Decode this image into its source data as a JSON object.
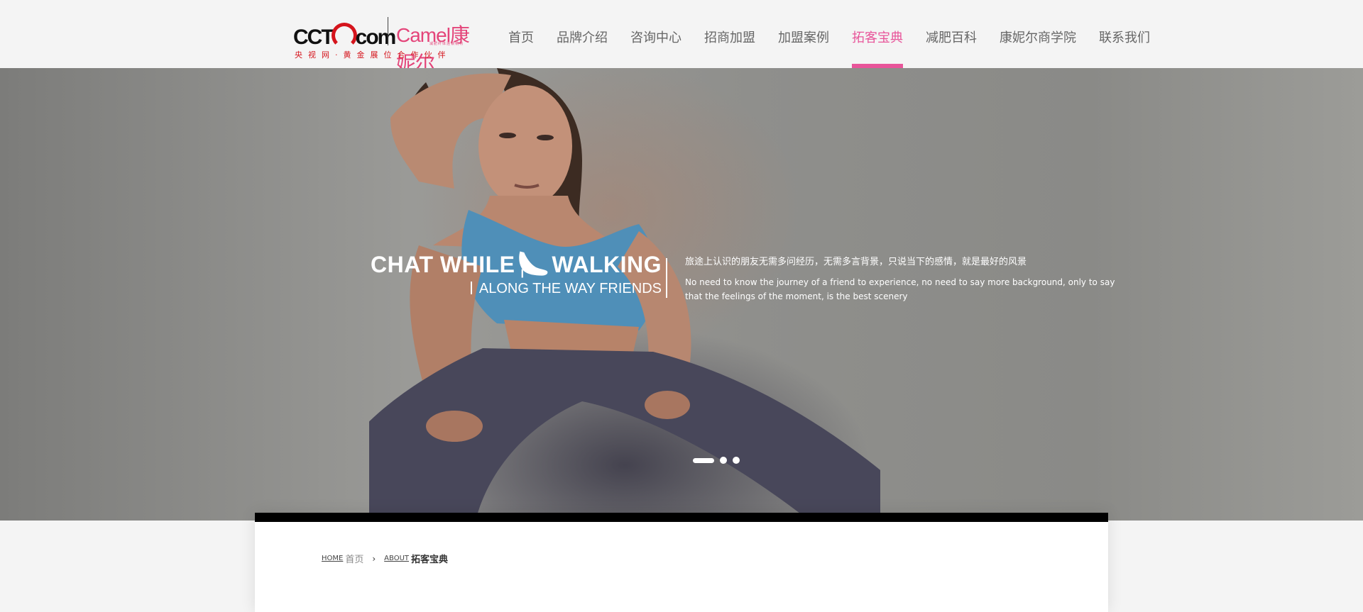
{
  "logo": {
    "cctv_pre": "CCT",
    "cctv_post": "com",
    "camel": "Camel康妮尔",
    "camel_sub": "减肥纤体连锁机构",
    "tagline": "央视网·黄金展位合作伙伴"
  },
  "nav": {
    "items": [
      {
        "label": "首页"
      },
      {
        "label": "品牌介绍"
      },
      {
        "label": "咨询中心"
      },
      {
        "label": "招商加盟"
      },
      {
        "label": "加盟案例"
      },
      {
        "label": "拓客宝典"
      },
      {
        "label": "减肥百科"
      },
      {
        "label": "康妮尔商学院"
      },
      {
        "label": "联系我们"
      }
    ],
    "active_index": 5,
    "accent_color": "#e8559a"
  },
  "banner": {
    "slogan_part1": "CHAT WHILE",
    "slogan_part2": "WALKING",
    "slogan_icon": "high-heel-icon",
    "slogan_sub": "ALONG THE WAY FRIENDS",
    "cn_text": "旅途上认识的朋友无需多问经历，无需多言背景，只说当下的感情，就是最好的风景",
    "en_text": "No need to know the journey of a friend to experience, no need to say more background, only to say that the feelings of the moment, is the best scenery",
    "slides": 3,
    "active_slide": 0
  },
  "breadcrumb": {
    "home_en": "HOME",
    "home_cn": "首页",
    "about_en": "ABOUT",
    "current": "拓客宝典",
    "arrow_icon": "chevron-right-icon"
  }
}
